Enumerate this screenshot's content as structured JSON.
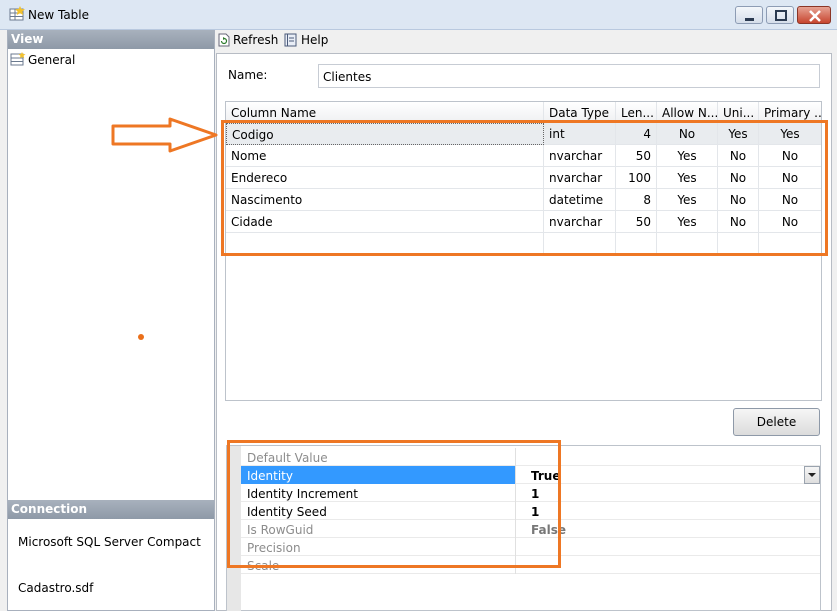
{
  "window": {
    "title": "New Table"
  },
  "left_pane": {
    "view_header": "View",
    "view_items": [
      {
        "label": "General"
      }
    ],
    "connection_header": "Connection",
    "connection_server": "Microsoft SQL Server Compact",
    "connection_file": "Cadastro.sdf"
  },
  "toolbar": {
    "refresh_label": "Refresh",
    "help_label": "Help"
  },
  "table_name": {
    "label": "Name:",
    "value": "Clientes"
  },
  "columns_grid": {
    "headers": [
      "Column Name",
      "Data Type",
      "Len...",
      "Allow N...",
      "Uni...",
      "Primary ..."
    ],
    "rows": [
      {
        "name": "Codigo",
        "type": "int",
        "length": "4",
        "allow_null": "No",
        "unique": "Yes",
        "primary": "Yes"
      },
      {
        "name": "Nome",
        "type": "nvarchar",
        "length": "50",
        "allow_null": "Yes",
        "unique": "No",
        "primary": "No"
      },
      {
        "name": "Endereco",
        "type": "nvarchar",
        "length": "100",
        "allow_null": "Yes",
        "unique": "No",
        "primary": "No"
      },
      {
        "name": "Nascimento",
        "type": "datetime",
        "length": "8",
        "allow_null": "Yes",
        "unique": "No",
        "primary": "No"
      },
      {
        "name": "Cidade",
        "type": "nvarchar",
        "length": "50",
        "allow_null": "Yes",
        "unique": "No",
        "primary": "No"
      }
    ]
  },
  "delete_button": {
    "label": "Delete"
  },
  "properties": [
    {
      "name": "Default Value",
      "value": ""
    },
    {
      "name": "Identity",
      "value": "True"
    },
    {
      "name": "Identity Increment",
      "value": "1"
    },
    {
      "name": "Identity Seed",
      "value": "1"
    },
    {
      "name": "Is RowGuid",
      "value": "False"
    },
    {
      "name": "Precision",
      "value": ""
    },
    {
      "name": "Scale",
      "value": ""
    }
  ],
  "colors": {
    "annotation": "#ee7724",
    "selection": "#3399ff"
  }
}
